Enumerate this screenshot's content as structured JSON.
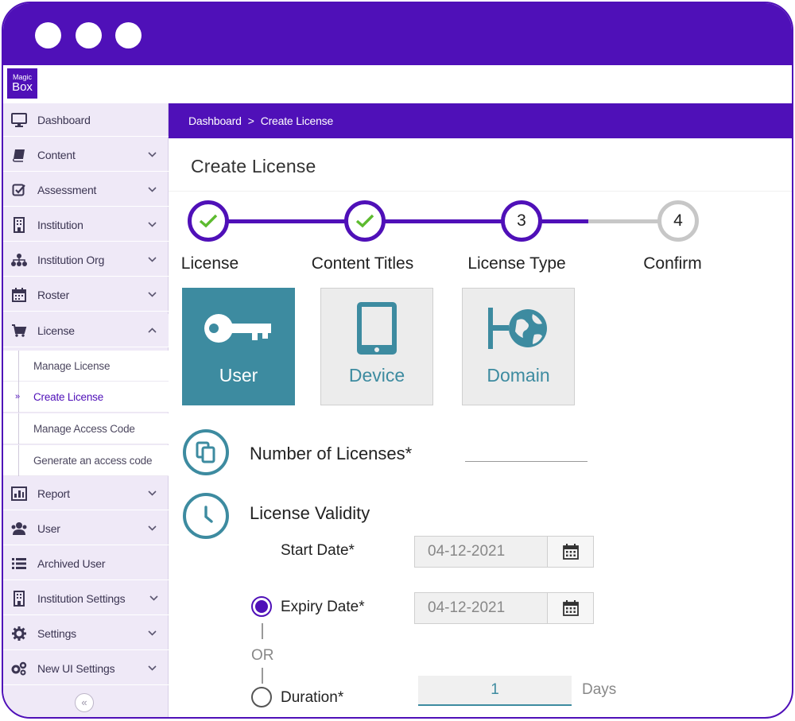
{
  "brand": {
    "logo_small": "Magic",
    "logo_big": "Box",
    "accent": "#4f10b8",
    "teal": "#3d8ba0"
  },
  "sidebar": {
    "items": [
      {
        "label": "Dashboard",
        "icon": "monitor-icon",
        "chevron": false
      },
      {
        "label": "Content",
        "icon": "book-icon",
        "chevron": true
      },
      {
        "label": "Assessment",
        "icon": "checkbox-icon",
        "chevron": true
      },
      {
        "label": "Institution",
        "icon": "building-icon",
        "chevron": true
      },
      {
        "label": "Institution Org",
        "icon": "org-chart-icon",
        "chevron": true
      },
      {
        "label": "Roster",
        "icon": "calendar-icon",
        "chevron": true
      },
      {
        "label": "License",
        "icon": "cart-icon",
        "chevron": true,
        "expanded": true
      }
    ],
    "subitems": [
      {
        "label": "Manage License"
      },
      {
        "label": "Create License",
        "active": true
      },
      {
        "label": "Manage Access Code"
      },
      {
        "label": "Generate an access code"
      }
    ],
    "items2": [
      {
        "label": "Report",
        "icon": "chart-icon",
        "chevron": true
      },
      {
        "label": "User",
        "icon": "users-icon",
        "chevron": true
      },
      {
        "label": "Archived User",
        "icon": "list-icon",
        "chevron": false
      },
      {
        "label": "Institution Settings",
        "icon": "building-icon",
        "chevron": true
      },
      {
        "label": "Settings",
        "icon": "gear-icon",
        "chevron": true
      },
      {
        "label": "New UI Settings",
        "icon": "gears-icon",
        "chevron": true
      }
    ],
    "collapse_glyph": "«"
  },
  "breadcrumb": {
    "root": "Dashboard",
    "separator": ">",
    "current": "Create License"
  },
  "page": {
    "title": "Create License"
  },
  "stepper": {
    "steps": [
      {
        "label": "License",
        "state": "done",
        "number": ""
      },
      {
        "label": "Content Titles",
        "state": "done",
        "number": ""
      },
      {
        "label": "License Type",
        "state": "current",
        "number": "3"
      },
      {
        "label": "Confirm",
        "state": "todo",
        "number": "4"
      }
    ]
  },
  "license_types": [
    {
      "label": "User",
      "icon": "key-icon",
      "selected": true
    },
    {
      "label": "Device",
      "icon": "tablet-icon",
      "selected": false
    },
    {
      "label": "Domain",
      "icon": "globe-network-icon",
      "selected": false
    }
  ],
  "form": {
    "num_licenses_label": "Number of Licenses*",
    "num_licenses_value": "",
    "validity_label": "License Validity",
    "start_date_label": "Start Date*",
    "start_date_value": "04-12-2021",
    "expiry_date_label": "Expiry Date*",
    "expiry_date_value": "04-12-2021",
    "or_label": "OR",
    "duration_label": "Duration*",
    "duration_value": "1",
    "duration_unit": "Days"
  }
}
